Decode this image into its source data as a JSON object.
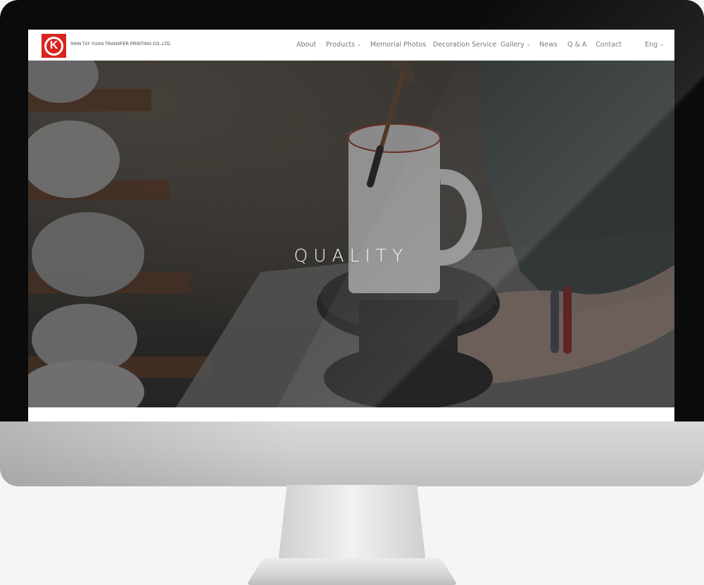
{
  "brand": {
    "logo_letter": "K",
    "company_name": "SHIN TAY YUAN TRANSFER PRINTING CO.,LTD."
  },
  "nav": {
    "items": [
      {
        "label": "About",
        "has_dropdown": false
      },
      {
        "label": "Products",
        "has_dropdown": true
      },
      {
        "label": "Memorial Photos",
        "has_dropdown": false
      },
      {
        "label": "Decoration Service",
        "has_dropdown": false
      },
      {
        "label": "Gallery",
        "has_dropdown": true
      },
      {
        "label": "News",
        "has_dropdown": false
      },
      {
        "label": "Q & A",
        "has_dropdown": false
      },
      {
        "label": "Contact",
        "has_dropdown": false
      }
    ],
    "language": {
      "label": "Eng",
      "has_dropdown": true
    },
    "dropdown_icon": "chevron-down-icon"
  },
  "hero": {
    "title": "QUALITY",
    "slides_count": 3,
    "active_slide": 1
  },
  "colors": {
    "brand_red": "#d8231f",
    "nav_text": "#777777",
    "hero_text": "#f4f4f4"
  }
}
